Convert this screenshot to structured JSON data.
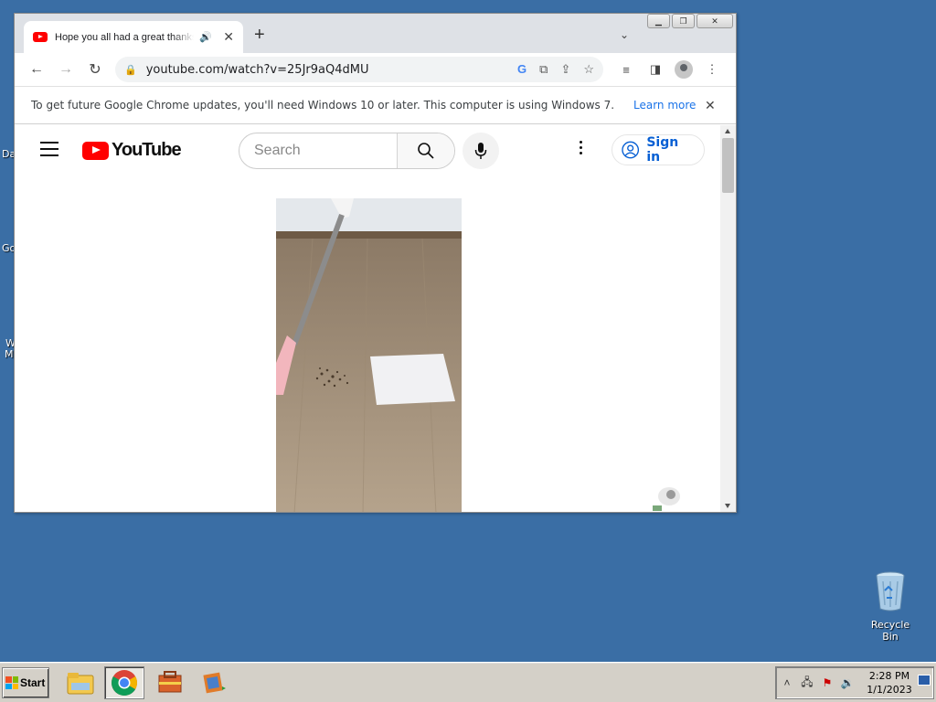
{
  "desktop": {
    "fragments": [
      "Da",
      "Go",
      "W",
      "M"
    ],
    "recycle_bin_label": "Recycle Bin"
  },
  "browser": {
    "tab_title": "Hope you all had a great thanksgiving",
    "new_tab_symbol": "+",
    "url": "youtube.com/watch?v=25Jr9aQ4dMU",
    "infobar": {
      "message": "To get future Google Chrome updates, you'll need Windows 10 or later. This computer is using Windows 7.",
      "link": "Learn more"
    }
  },
  "youtube": {
    "logo_text": "YouTube",
    "search_placeholder": "Search",
    "signin_label": "Sign in"
  },
  "taskbar": {
    "start_label": "Start",
    "time": "2:28 PM",
    "date": "1/1/2023"
  },
  "colors": {
    "desktop": "#3a6ea5",
    "youtube_red": "#ff0000",
    "link_blue": "#065fd4"
  }
}
